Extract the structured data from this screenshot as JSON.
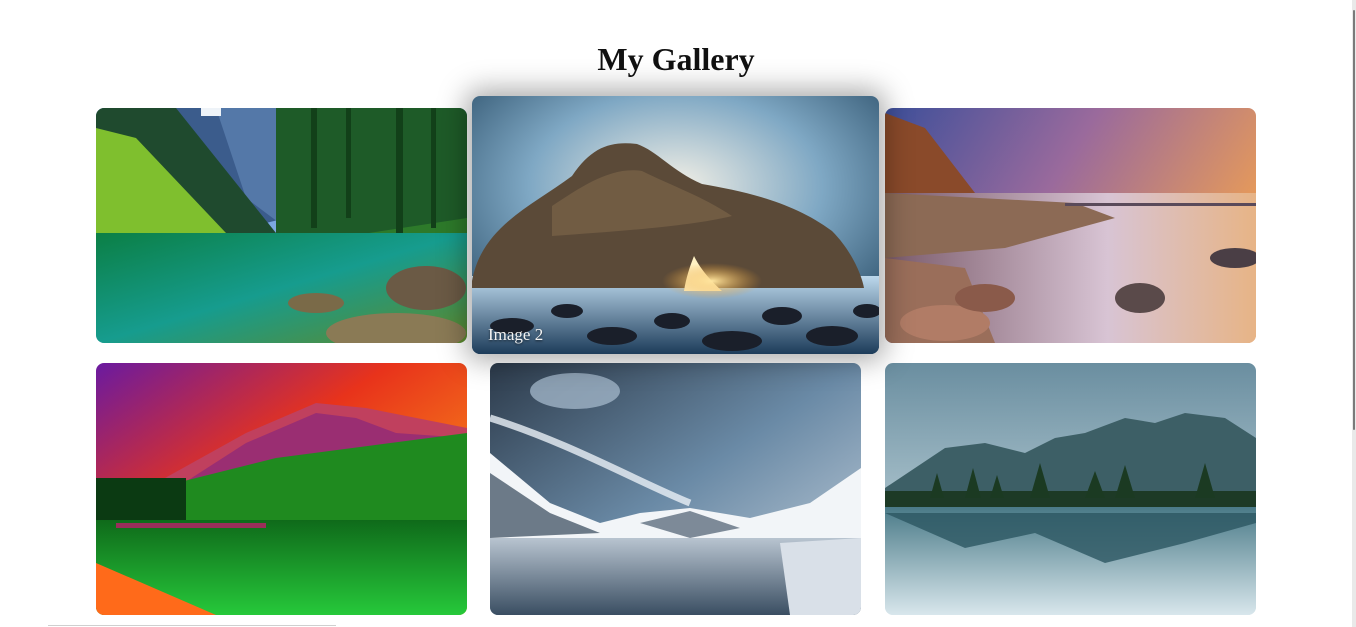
{
  "page": {
    "title": "My Gallery"
  },
  "gallery": {
    "images": [
      {
        "caption": "",
        "scene": "alpine lake with green forest"
      },
      {
        "caption": "Image 2",
        "scene": "sea arch rock at sunset",
        "hovered": true
      },
      {
        "caption": "",
        "scene": "rocky coast with purple sunset sky"
      },
      {
        "caption": "",
        "scene": "red sky mountain with green forest reflection"
      },
      {
        "caption": "",
        "scene": "snowy mountains reflected in lake"
      },
      {
        "caption": "",
        "scene": "teal mountain range reflected in lake"
      }
    ]
  }
}
